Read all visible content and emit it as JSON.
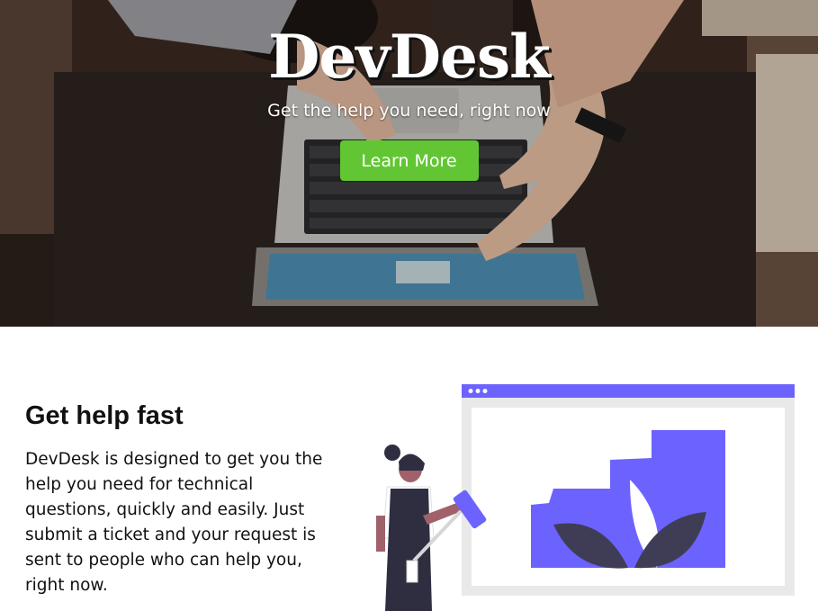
{
  "hero": {
    "brand": "DevDesk",
    "tagline": "Get the help you need, right now",
    "cta_label": "Learn More",
    "cta_color": "#62c634"
  },
  "feature": {
    "title": "Get help fast",
    "body": "DevDesk is designed to get you the help you need for technical questions, quickly and easily. Just submit a ticket and your request is sent to people who can help you, right now."
  },
  "colors": {
    "accent": "#6c63ff",
    "text": "#111111"
  },
  "icons": [
    "laptop-photo",
    "painter-illustration",
    "browser-window"
  ]
}
